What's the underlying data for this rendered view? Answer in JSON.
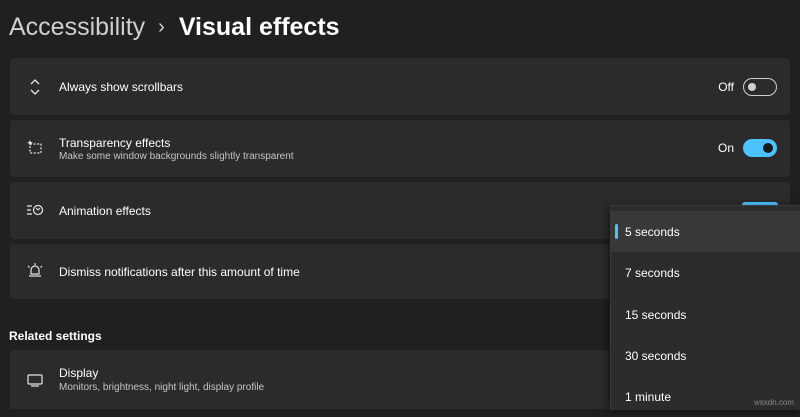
{
  "breadcrumb": {
    "parent": "Accessibility",
    "separator": "›",
    "current": "Visual effects"
  },
  "settings": [
    {
      "title": "Always show scrollbars",
      "description": "",
      "icon": "scrollbar-arrows-icon",
      "toggle_label": "Off",
      "toggle_state": "off"
    },
    {
      "title": "Transparency effects",
      "description": "Make some window backgrounds slightly transparent",
      "icon": "transparency-icon",
      "toggle_label": "On",
      "toggle_state": "on"
    },
    {
      "title": "Animation effects",
      "description": "",
      "icon": "animation-icon",
      "toggle_state": "on"
    },
    {
      "title": "Dismiss notifications after this amount of time",
      "description": "",
      "icon": "notification-timer-icon"
    }
  ],
  "related": {
    "heading": "Related settings",
    "items": [
      {
        "title": "Display",
        "description": "Monitors, brightness, night light, display profile",
        "icon": "monitor-icon"
      }
    ]
  },
  "dropdown": {
    "selected": "5 seconds",
    "options": [
      "5 seconds",
      "7 seconds",
      "15 seconds",
      "30 seconds",
      "1 minute"
    ]
  },
  "watermark": "wsxdn.com",
  "colors": {
    "accent": "#4cc2ff",
    "background": "#202020",
    "card": "#2b2b2b"
  }
}
